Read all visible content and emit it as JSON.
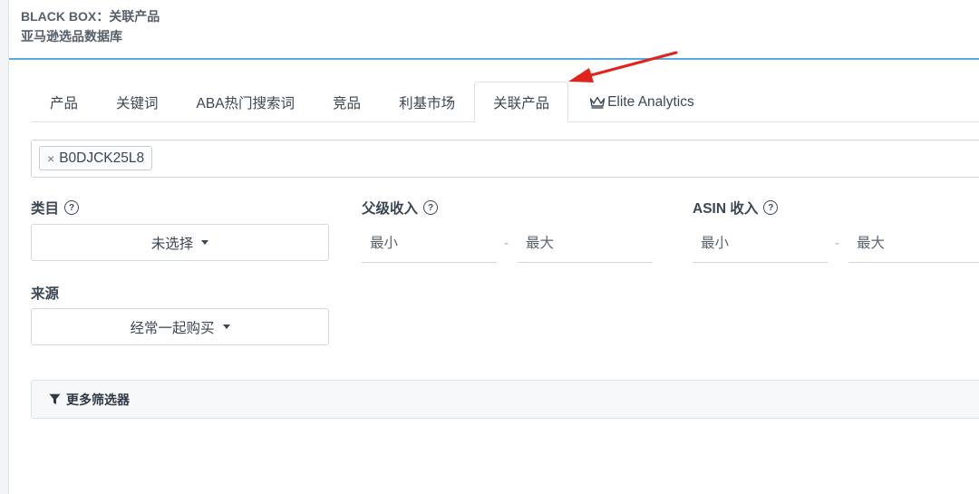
{
  "header": {
    "title_line1": "BLACK BOX：关联产品",
    "title_line2": "亚马逊选品数据库"
  },
  "tabs": [
    {
      "label": "产品"
    },
    {
      "label": "关键词"
    },
    {
      "label": "ABA热门搜索词"
    },
    {
      "label": "竞品"
    },
    {
      "label": "利基市场"
    },
    {
      "label": "关联产品",
      "active": true
    },
    {
      "label": "Elite Analytics",
      "icon": "crown-icon"
    }
  ],
  "asin_tags": [
    "B0DJCK25L8"
  ],
  "filters": {
    "category": {
      "label": "类目",
      "value": "未选择"
    },
    "parent_revenue": {
      "label": "父级收入",
      "min_placeholder": "最小",
      "max_placeholder": "最大",
      "separator": "-"
    },
    "asin_revenue": {
      "label": "ASIN 收入",
      "min_placeholder": "最小",
      "max_placeholder": "最大",
      "separator": "-"
    },
    "source": {
      "label": "来源",
      "value": "经常一起购买"
    },
    "more_filters_label": "更多筛选器"
  },
  "colors": {
    "accent_line": "#5aa9dc",
    "annotation_arrow": "#e0231b"
  }
}
